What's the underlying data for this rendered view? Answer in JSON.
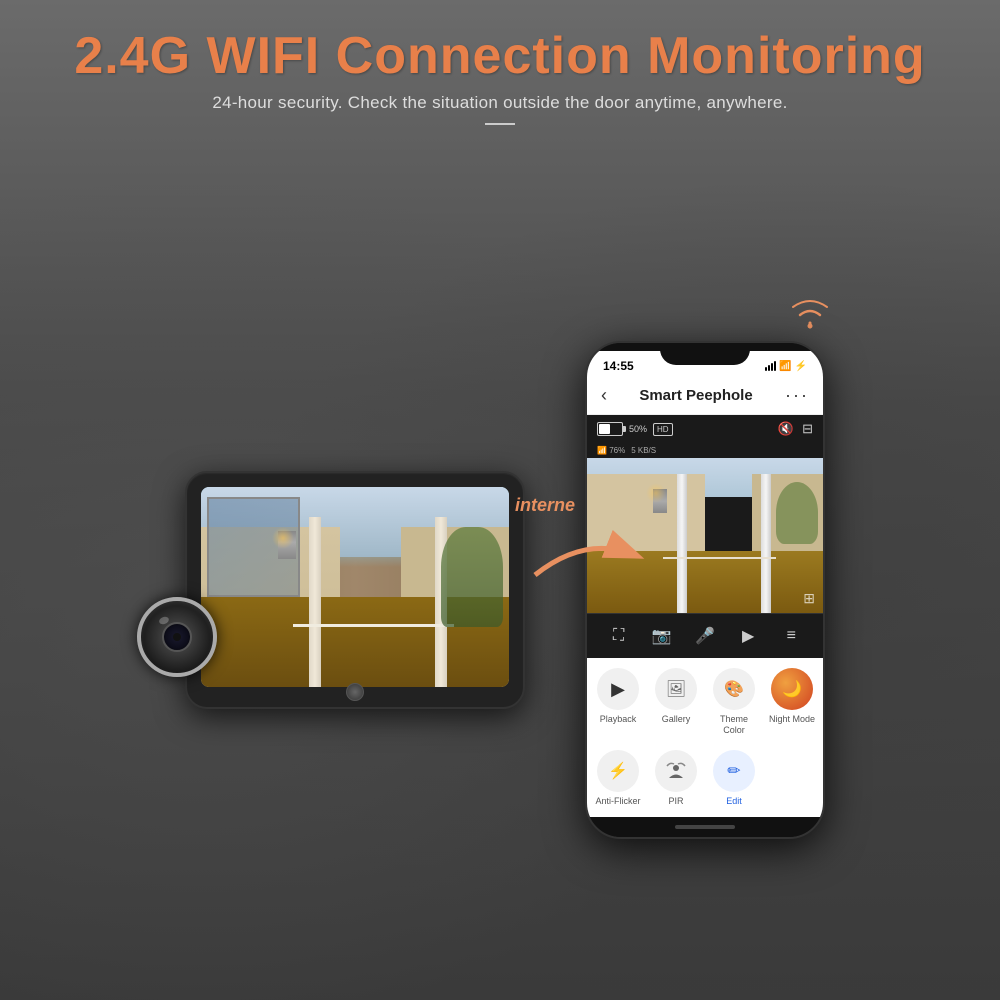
{
  "header": {
    "main_title": "2.4G WIFI Connection Monitoring",
    "sub_title": "24-hour security. Check the situation outside the door anytime, anywhere."
  },
  "arrow_label": "interne",
  "status_bar": {
    "time": "14:55",
    "battery_pct": "50%",
    "hd_label": "HD",
    "wifi_pct": "76%",
    "speed": "5 KB/S"
  },
  "app": {
    "nav_back": "‹",
    "nav_title": "Smart Peephole",
    "nav_menu": "···",
    "mute_label": "🔇",
    "screen_label": "⊟"
  },
  "features": [
    {
      "label": "Playback",
      "icon": "▶",
      "color": "#f0f0f0"
    },
    {
      "label": "Gallery",
      "icon": "🖼",
      "color": "#f0f0f0"
    },
    {
      "label": "Theme\nColor",
      "icon": "🎨",
      "color": "#f0f0f0"
    },
    {
      "label": "Night\nMode",
      "icon": "🌙",
      "color": "#e87020"
    }
  ],
  "features2": [
    {
      "label": "Anti-Flick\ner",
      "icon": "⚡",
      "color": "#f0f0f0"
    },
    {
      "label": "PIR",
      "icon": "👁",
      "color": "#f0f0f0"
    },
    {
      "label": "Edit",
      "icon": "✏",
      "color": "#2060e0"
    }
  ]
}
